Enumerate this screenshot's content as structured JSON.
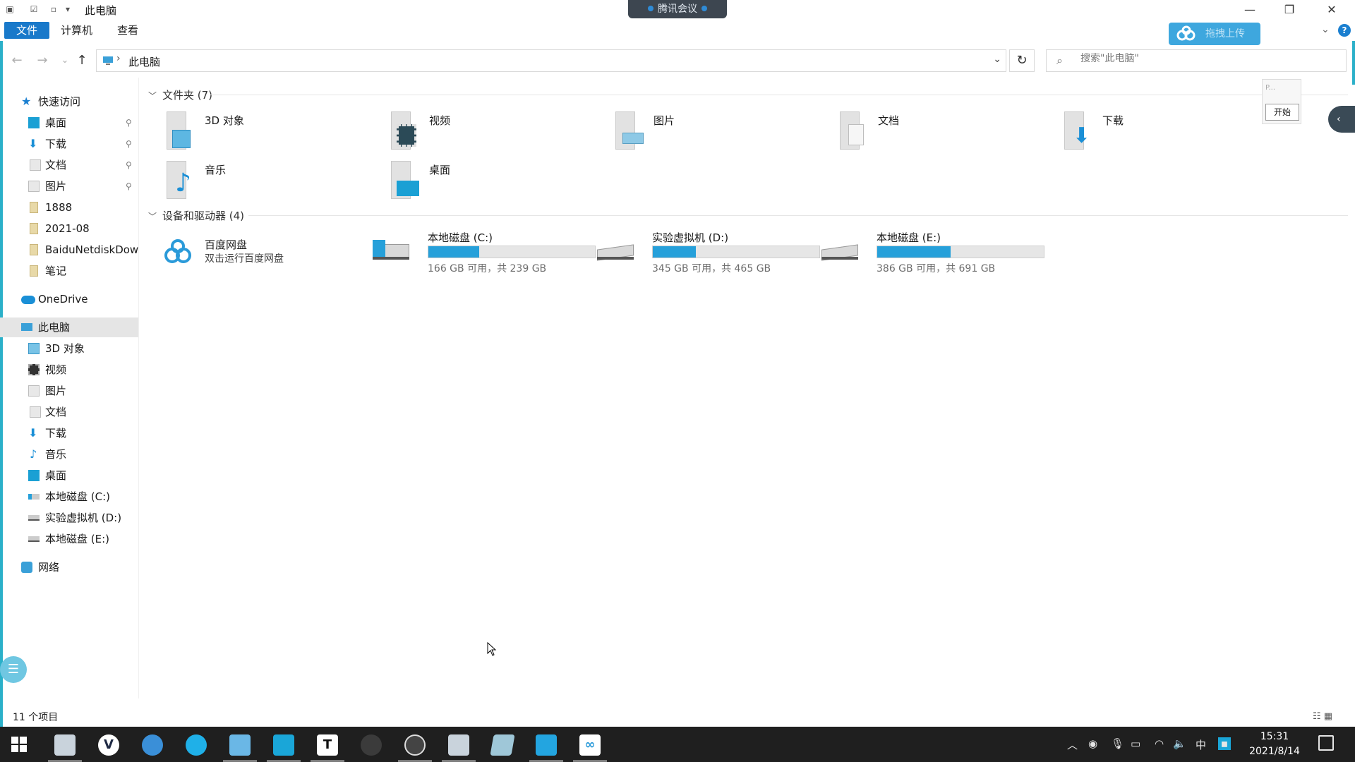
{
  "window": {
    "title": "此电脑",
    "meeting_label": "腾讯会议",
    "minimize": "—",
    "restore": "❐",
    "close": "✕"
  },
  "ribbon": {
    "tabs": [
      "文件",
      "计算机",
      "查看"
    ],
    "upload_label": "拖拽上传"
  },
  "nav": {
    "back": "←",
    "forward": "→",
    "recent": "⌄",
    "up": "↑",
    "address": "此电脑",
    "separator": "›",
    "refresh": "↻",
    "search_placeholder": "搜索\"此电脑\""
  },
  "sidebar": {
    "quick_access": "快速访问",
    "quick_items": [
      "桌面",
      "下载",
      "文档",
      "图片",
      "1888",
      "2021-08",
      "BaiduNetdiskDow",
      "笔记"
    ],
    "onedrive": "OneDrive",
    "this_pc": "此电脑",
    "pc_items": [
      "3D 对象",
      "视频",
      "图片",
      "文档",
      "下载",
      "音乐",
      "桌面",
      "本地磁盘 (C:)",
      "实验虚拟机 (D:)",
      "本地磁盘 (E:)"
    ],
    "network": "网络"
  },
  "content": {
    "folders_header": "文件夹 (7)",
    "folders": [
      "3D 对象",
      "视频",
      "图片",
      "文档",
      "下载",
      "音乐",
      "桌面"
    ],
    "devices_header": "设备和驱动器 (4)",
    "baidu": {
      "name": "百度网盘",
      "sub": "双击运行百度网盘"
    },
    "drives": [
      {
        "name": "本地磁盘 (C:)",
        "free_text": "166 GB 可用，共 239 GB",
        "used_fraction": 0.305
      },
      {
        "name": "实验虚拟机 (D:)",
        "free_text": "345 GB 可用，共 465 GB",
        "used_fraction": 0.258
      },
      {
        "name": "本地磁盘 (E:)",
        "free_text": "386 GB 可用，共 691 GB",
        "used_fraction": 0.441
      }
    ]
  },
  "widget": {
    "tiny_text": "P...",
    "start_label": "开始"
  },
  "status": {
    "count": "11 个项目"
  },
  "taskbar": {
    "clock_time": "15:31",
    "clock_date": "2021/8/14",
    "ime": "中",
    "app_t": "T",
    "app_v": "V"
  },
  "colors": {
    "accent": "#1979ca",
    "drive_fill": "#26a0da",
    "taskbar": "#1f1f1f"
  }
}
